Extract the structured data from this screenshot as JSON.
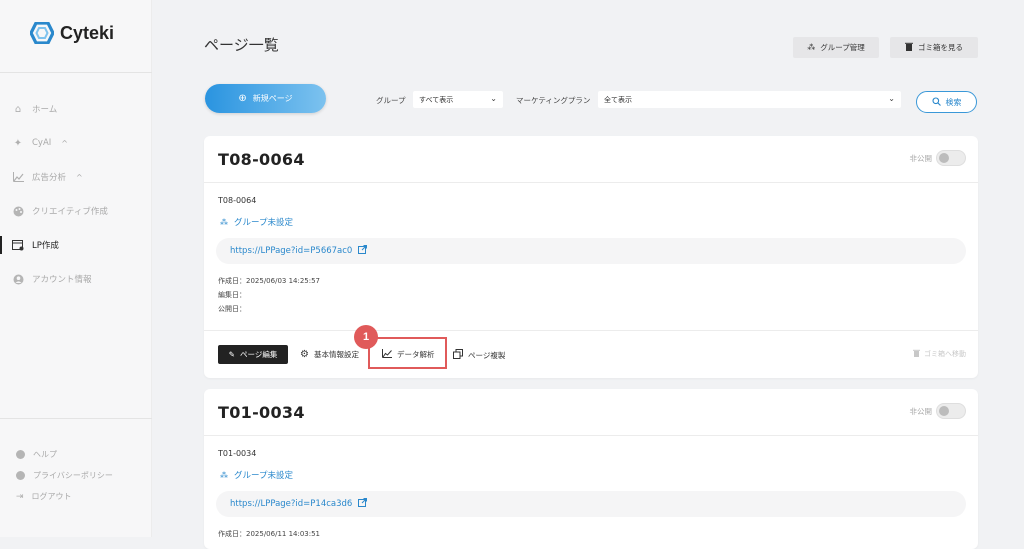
{
  "brand": {
    "name": "Cyteki",
    "color": "#2a88cc"
  },
  "sidebar": {
    "items": [
      {
        "label": "ホーム",
        "icon": "home-icon"
      },
      {
        "label": "CyAI",
        "icon": "sparkle-icon",
        "chevron": "^"
      },
      {
        "label": "広告分析",
        "icon": "chart-icon",
        "chevron": "^"
      },
      {
        "label": "クリエイティブ作成",
        "icon": "palette-icon"
      },
      {
        "label": "LP作成",
        "icon": "lp-icon"
      },
      {
        "label": "アカウント情報",
        "icon": "account-icon"
      }
    ],
    "footer": [
      {
        "label": "ヘルプ"
      },
      {
        "label": "プライバシーポリシー"
      },
      {
        "label": "ログアウト"
      }
    ]
  },
  "header": {
    "title": "ページ一覧",
    "group_manage": "グループ管理",
    "trash_view": "ゴミ箱を見る"
  },
  "toolbar": {
    "new_page": "新規ページ",
    "group_label": "グループ",
    "group_value": "すべて表示",
    "plan_label": "マーケティングプラン",
    "plan_value": "全て表示",
    "search": "検索"
  },
  "cards": [
    {
      "title": "T08-0064",
      "visibility": "非公開",
      "name": "T08-0064",
      "group": "グループ未設定",
      "url": "https://LPPage?id=P5667ac0",
      "created": "作成日：2025/06/03 14:25:57",
      "edited": "編集日：",
      "published": "公開日：",
      "actions": {
        "edit": "ページ編集",
        "settings": "基本情報設定",
        "analytics": "データ解析",
        "duplicate": "ページ複製",
        "trash": "ゴミ箱へ移動"
      }
    },
    {
      "title": "T01-0034",
      "visibility": "非公開",
      "name": "T01-0034",
      "group": "グループ未設定",
      "url": "https://LPPage?id=P14ca3d6",
      "created": "作成日：2025/06/11 14:03:51"
    }
  ],
  "annotation": {
    "step": "1",
    "color": "#e05a5a"
  }
}
